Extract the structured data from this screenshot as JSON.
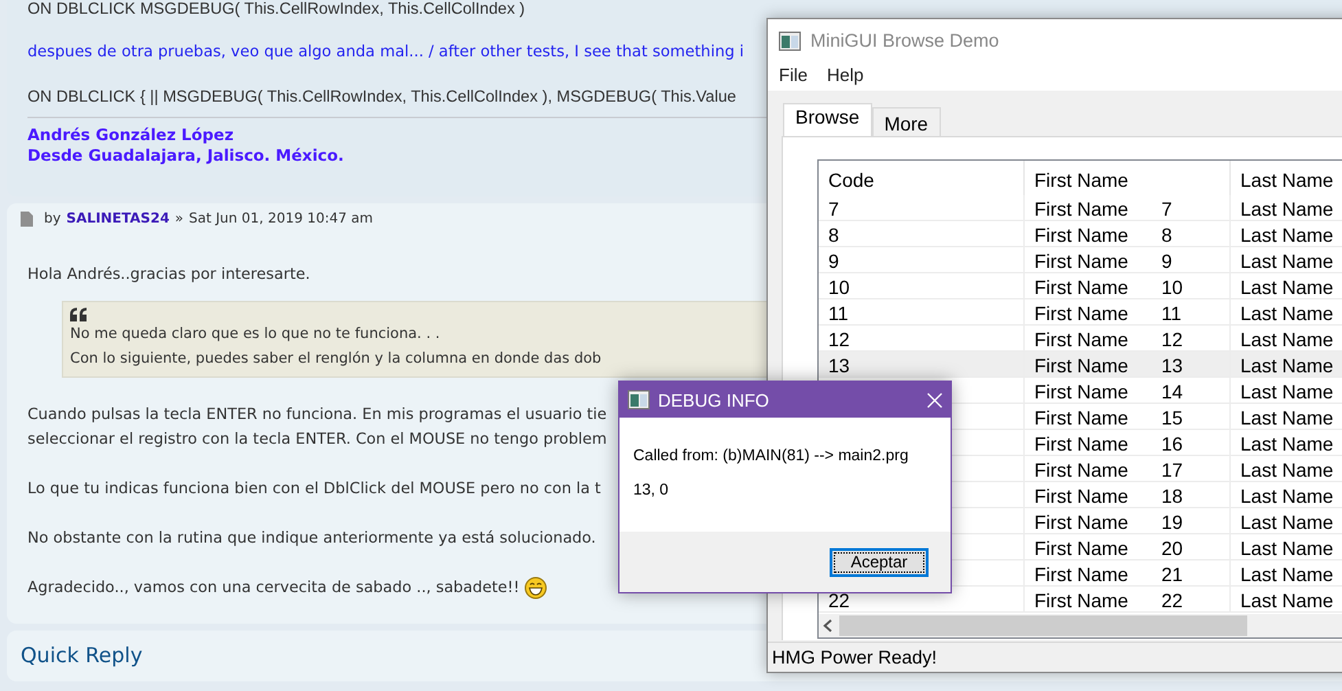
{
  "forum": {
    "post_top": {
      "lines": [
        {
          "kind": "code",
          "text": "ON DBLCLICK MSGDEBUG( This.CellRowIndex, This.CellColIndex )"
        },
        {
          "kind": "blue",
          "text": "despues de otra pruebas, veo que algo anda mal... / after other tests, I see that something i"
        },
        {
          "kind": "code",
          "text": "ON DBLCLICK { || MSGDEBUG( This.CellRowIndex, This.CellColIndex ), MSGDEBUG( This.Value"
        }
      ],
      "signature": [
        "Andrés González López",
        "Desde Guadalajara, Jalisco. México."
      ]
    },
    "post": {
      "by": "by",
      "author": "SALINETAS24",
      "separator": "»",
      "date": "Sat Jun 01, 2019 10:47 am",
      "greeting": "Hola Andrés..gracias por interesarte.",
      "quote": [
        "No me queda claro que es lo que no te funciona. . .",
        "Con lo siguiente, puedes saber el renglón y la columna en donde das dob"
      ],
      "paragraphs": [
        [
          "Cuando pulsas la tecla ENTER no funciona. En mis programas el usuario tie",
          "seleccionar el registro con la tecla ENTER. Con el MOUSE no tengo problem"
        ],
        [
          "Lo que tu indicas funciona bien con el DblClick del MOUSE pero no con la t"
        ],
        [
          "No obstante con la rutina que indique anteriormente ya está solucionado."
        ]
      ],
      "closing": "Agradecido.., vamos con una cervecita de sabado .., sabadete!!"
    },
    "quick_reply": "Quick Reply"
  },
  "browse_window": {
    "title": "MiniGUI Browse Demo",
    "menu": [
      "File",
      "Help"
    ],
    "tabs": [
      {
        "label": "Browse",
        "selected": true
      },
      {
        "label": "More",
        "selected": false
      }
    ],
    "columns": [
      "Code",
      "First Name",
      "Last Name"
    ],
    "rows": [
      {
        "code": "7",
        "first_name": "First Name",
        "number": "7",
        "last_name": "Last Name",
        "selected": false
      },
      {
        "code": "8",
        "first_name": "First Name",
        "number": "8",
        "last_name": "Last Name",
        "selected": false
      },
      {
        "code": "9",
        "first_name": "First Name",
        "number": "9",
        "last_name": "Last Name",
        "selected": false
      },
      {
        "code": "10",
        "first_name": "First Name",
        "number": "10",
        "last_name": "Last Name",
        "selected": false
      },
      {
        "code": "11",
        "first_name": "First Name",
        "number": "11",
        "last_name": "Last Name",
        "selected": false
      },
      {
        "code": "12",
        "first_name": "First Name",
        "number": "12",
        "last_name": "Last Name",
        "selected": false
      },
      {
        "code": "13",
        "first_name": "First Name",
        "number": "13",
        "last_name": "Last Name",
        "selected": true
      },
      {
        "first_name": "First Name",
        "number": "14",
        "last_name": "Last Name",
        "selected": false
      },
      {
        "first_name": "First Name",
        "number": "15",
        "last_name": "Last Name",
        "selected": false
      },
      {
        "first_name": "First Name",
        "number": "16",
        "last_name": "Last Name",
        "selected": false
      },
      {
        "first_name": "First Name",
        "number": "17",
        "last_name": "Last Name",
        "selected": false
      },
      {
        "first_name": "First Name",
        "number": "18",
        "last_name": "Last Name",
        "selected": false
      },
      {
        "first_name": "First Name",
        "number": "19",
        "last_name": "Last Name",
        "selected": false
      },
      {
        "first_name": "First Name",
        "number": "20",
        "last_name": "Last Name",
        "selected": false
      },
      {
        "first_name": "First Name",
        "number": "21",
        "last_name": "Last Name",
        "selected": false
      },
      {
        "code": "22",
        "first_name": "First Name",
        "number": "22",
        "last_name": "Last Name",
        "selected": false
      }
    ],
    "status_bar": "HMG Power Ready!"
  },
  "dialog": {
    "title": "DEBUG INFO",
    "lines": [
      "Called from: (b)MAIN(81) --> main2.prg",
      "13, 0"
    ],
    "button": "Aceptar"
  }
}
